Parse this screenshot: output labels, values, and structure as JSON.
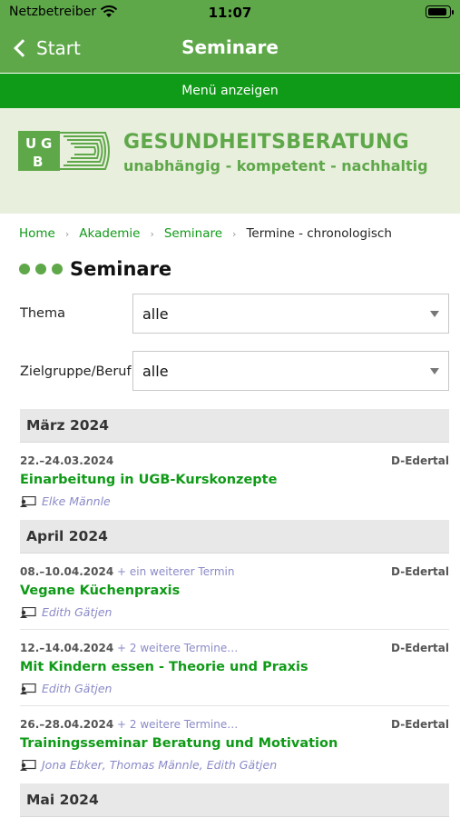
{
  "status": {
    "carrier": "Netzbetreiber",
    "time": "11:07",
    "battery_level": 0.95
  },
  "nav": {
    "back_label": "Start",
    "title": "Seminare"
  },
  "menu": {
    "label": "Menü anzeigen"
  },
  "banner": {
    "logo_text": "UGB",
    "title": "GESUNDHEITSBERATUNG",
    "subtitle": "unabhängig - kompetent - nachhaltig"
  },
  "breadcrumb": {
    "items": [
      "Home",
      "Akademie",
      "Seminare"
    ],
    "current": "Termine - chronologisch"
  },
  "page": {
    "title": "Seminare"
  },
  "filters": {
    "topic": {
      "label": "Thema",
      "value": "alle"
    },
    "audience": {
      "label": "Zielgruppe/Beruf",
      "value": "alle"
    }
  },
  "months": [
    "März 2024",
    "April 2024",
    "Mai 2024"
  ],
  "events": [
    {
      "date": "22.–24.03.2024",
      "more": "",
      "location": "D-Edertal",
      "title": "Einarbeitung in UGB-Kurskonzepte",
      "people": [
        "Elke Männle"
      ]
    },
    {
      "date": "08.–10.04.2024",
      "more": "+ ein weiterer Termin",
      "location": "D-Edertal",
      "title": "Vegane Küchenpraxis",
      "people": [
        "Edith Gätjen"
      ]
    },
    {
      "date": "12.–14.04.2024",
      "more": "+ 2 weitere Termine…",
      "location": "D-Edertal",
      "title": "Mit Kindern essen - Theorie und Praxis",
      "people": [
        "Edith Gätjen"
      ]
    },
    {
      "date": "26.–28.04.2024",
      "more": "+ 2 weitere Termine…",
      "location": "D-Edertal",
      "title": "Trainingsseminar Beratung und Motivation",
      "people": [
        "Jona Ebker",
        "Thomas Männle",
        "Edith Gätjen"
      ]
    }
  ],
  "colors": {
    "header_green": "#5fa84a",
    "menu_green": "#0f9a17",
    "link_green": "#0f9a17",
    "person_purple": "#8a8ac8"
  }
}
